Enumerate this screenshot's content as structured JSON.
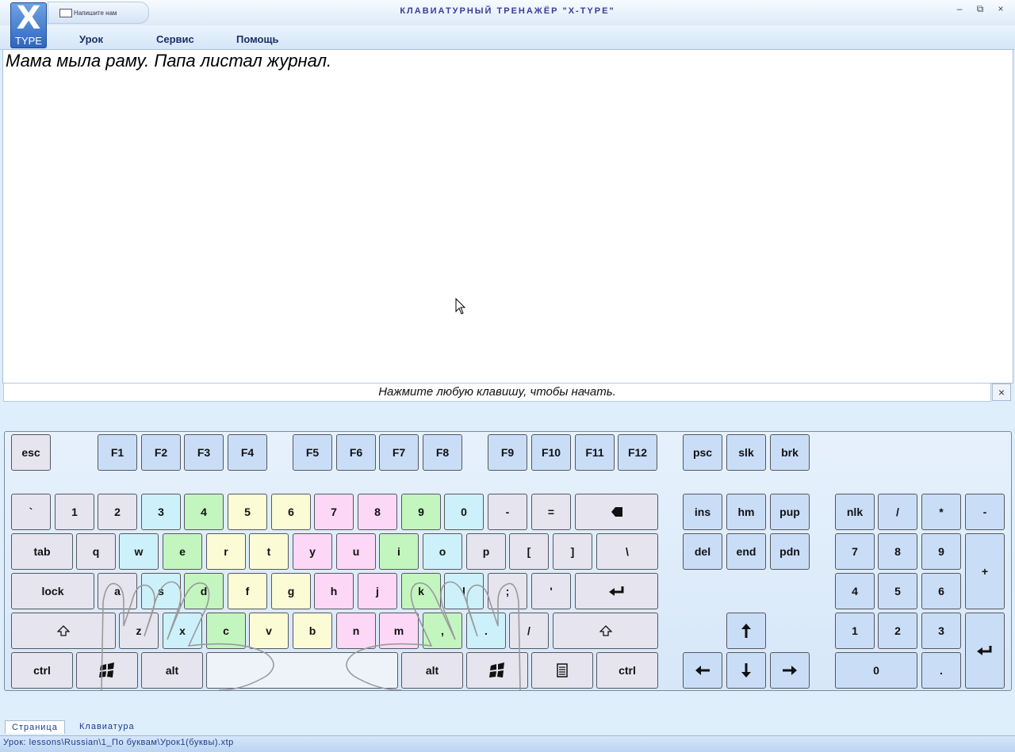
{
  "app": {
    "logo_text": "X",
    "logo_subtext": "TYPE",
    "quick_access_label": "Напишите нам",
    "window_title": "КЛАВИАТУРНЫЙ ТРЕНАЖЁР \"X-TYPE\""
  },
  "menu": {
    "items": [
      "Урок",
      "Сервис",
      "Помощь"
    ]
  },
  "lesson": {
    "text": "Мама мыла раму. Папа листал журнал."
  },
  "status": {
    "message": "Нажмите любую клавишу, чтобы начать.",
    "close_symbol": "×"
  },
  "tabs": [
    "Страница",
    "Клавиатура"
  ],
  "path": "Урок: lessons\\Russian\\1_По буквам\\Урок1(буквы).xtp",
  "colors": {
    "gray": "#e6e4ef",
    "blue": "#c9ddf7",
    "cyan": "#cdf1fb",
    "green": "#c3f5bf",
    "yellow": "#fbfcd6",
    "pink": "#fcd7f6"
  },
  "keyboard": {
    "rows": {
      "function": [
        "esc",
        "F1",
        "F2",
        "F3",
        "F4",
        "F5",
        "F6",
        "F7",
        "F8",
        "F9",
        "F10",
        "F11",
        "F12",
        "psc",
        "slk",
        "brk"
      ],
      "number": [
        "`",
        "1",
        "2",
        "3",
        "4",
        "5",
        "6",
        "7",
        "8",
        "9",
        "0",
        "-",
        "=",
        "backspace"
      ],
      "top": [
        "tab",
        "q",
        "w",
        "e",
        "r",
        "t",
        "y",
        "u",
        "i",
        "o",
        "p",
        "[",
        "]",
        "\\"
      ],
      "home": [
        "lock",
        "a",
        "s",
        "d",
        "f",
        "g",
        "h",
        "j",
        "k",
        "l",
        ";",
        "'",
        "enter"
      ],
      "bottom": [
        "shift",
        "z",
        "x",
        "c",
        "v",
        "b",
        "n",
        "m",
        ",",
        ".",
        "/",
        "shift"
      ],
      "space": [
        "ctrl",
        "win",
        "alt",
        "space",
        "alt",
        "win",
        "menu",
        "ctrl"
      ]
    },
    "nav": [
      "ins",
      "hm",
      "pup",
      "del",
      "end",
      "pdn"
    ],
    "arrows": [
      "up",
      "left",
      "down",
      "right"
    ],
    "numpad": [
      "nlk",
      "/",
      "*",
      "-",
      "7",
      "8",
      "9",
      "+",
      "4",
      "5",
      "6",
      "1",
      "2",
      "3",
      "enter",
      "0",
      "."
    ]
  }
}
